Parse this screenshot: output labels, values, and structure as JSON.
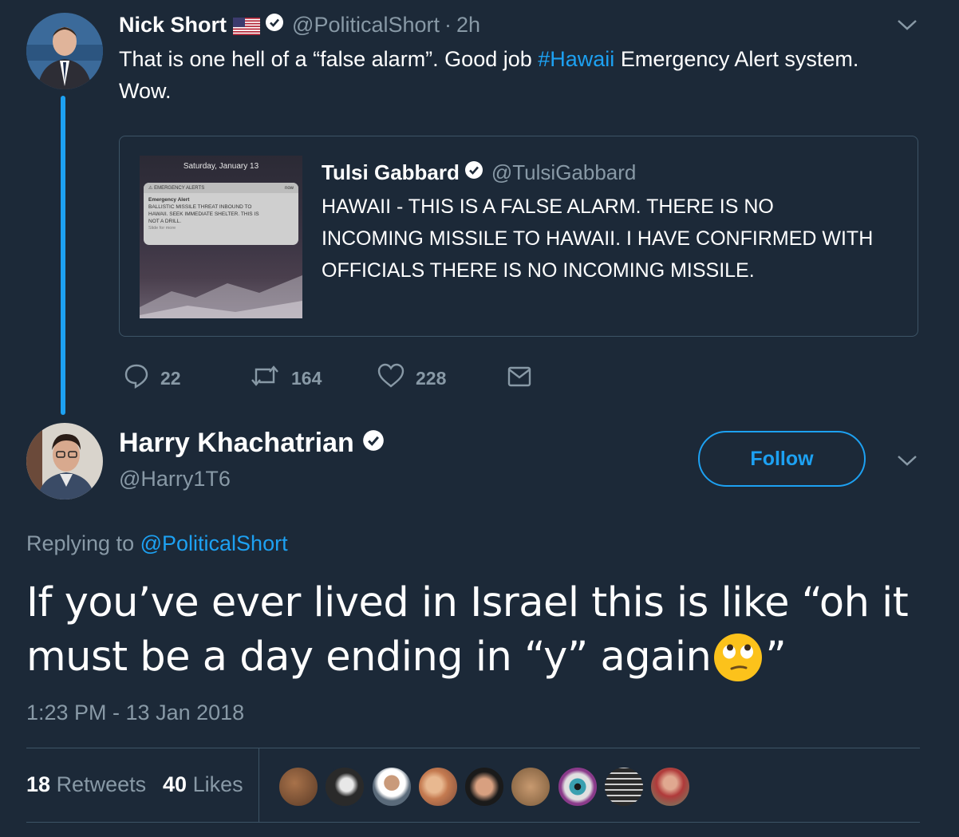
{
  "first_tweet": {
    "author_name": "Nick Short",
    "handle": "@PoliticalShort",
    "separator": "·",
    "time": "2h",
    "text_part1": "That is one hell of a “false alarm”. Good job ",
    "hashtag": "#Hawaii",
    "text_part2": " Emergency Alert system.",
    "text_line2": "Wow.",
    "quoted": {
      "author_name": "Tulsi Gabbard",
      "handle": "@TulsiGabbard",
      "text_line1": "HAWAII - THIS IS A FALSE ALARM. THERE IS NO",
      "text_line2": "INCOMING MISSILE TO HAWAII. I HAVE CONFIRMED WITH",
      "text_line3": "OFFICIALS THERE IS NO INCOMING MISSILE.",
      "image": {
        "date": "Saturday, January 13",
        "alert_header": "EMERGENCY ALERTS",
        "alert_time": "now",
        "alert_title": "Emergency Alert",
        "alert_line1": "BALLISTIC MISSILE THREAT INBOUND TO",
        "alert_line2": "HAWAII. SEEK IMMEDIATE SHELTER. THIS IS",
        "alert_line3": "NOT A DRILL.",
        "alert_slide": "Slide for more"
      }
    },
    "replies": "22",
    "retweets": "164",
    "likes": "228"
  },
  "main_tweet": {
    "author_name": "Harry Khachatrian",
    "handle": "@Harry1T6",
    "follow_label": "Follow",
    "replying_prefix": "Replying to ",
    "replying_handle": "@PoliticalShort",
    "text_line1": "If you’ve ever lived in Israel this is like “oh it",
    "text_line2_a": "must be a day ending in “y” again",
    "text_line2_b": "”",
    "timestamp": "1:23 PM - 13 Jan 2018",
    "retweet_count": "18",
    "retweet_label": "Retweets",
    "like_count": "40",
    "like_label": "Likes"
  },
  "colors": {
    "background": "#1c2938",
    "accent": "#1da1f2",
    "muted": "#8899a6",
    "thread_line": "#1da1f2"
  }
}
